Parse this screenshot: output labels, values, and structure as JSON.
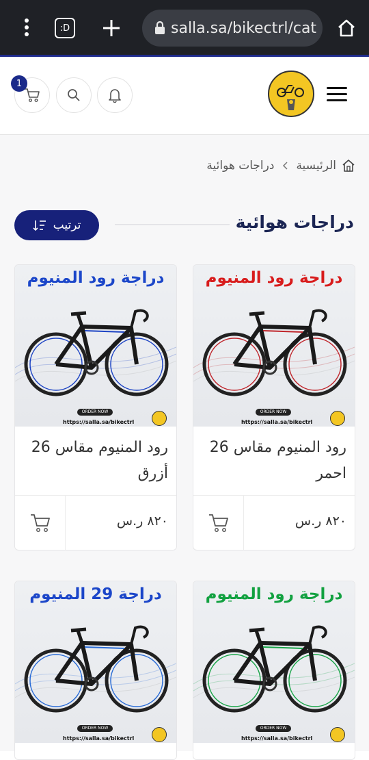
{
  "browser": {
    "url": "salla.sa/bikectrl/cat",
    "tab_label": ":D"
  },
  "header": {
    "cart_count": "1"
  },
  "breadcrumb": {
    "home": "الرئيسية",
    "current": "دراجات هوائية"
  },
  "page": {
    "title": "دراجات هوائية",
    "sort_label": "ترتيب"
  },
  "colors": {
    "primary": "#17217a",
    "badge": "#1b2a8a",
    "title": "#1b2553",
    "logo_yellow": "#f3c623"
  },
  "products": [
    {
      "image_title": "دراجة رود المنيوم",
      "image_title_color": "#d81c1c",
      "bike_accent": "#c0262c",
      "name": "رود المنيوم مقاس 26 احمر",
      "price": "٨٢٠ ر.س",
      "order_label": "ORDER NOW",
      "site": "https://salla.sa/bikectrl"
    },
    {
      "image_title": "دراجة رود المنيوم",
      "image_title_color": "#1b46c9",
      "bike_accent": "#1d44c4",
      "name": "رود المنيوم مقاس 26 أزرق",
      "price": "٨٢٠ ر.س",
      "order_label": "ORDER NOW",
      "site": "https://salla.sa/bikectrl"
    },
    {
      "image_title": "دراجة رود المنيوم",
      "image_title_color": "#12a140",
      "bike_accent": "#19a548",
      "name": "",
      "price": "",
      "order_label": "ORDER NOW",
      "site": "https://salla.sa/bikectrl"
    },
    {
      "image_title": "دراجة 29 المنيوم",
      "image_title_color": "#1b46c9",
      "bike_accent": "#2a6cd6",
      "name": "",
      "price": "",
      "order_label": "ORDER NOW",
      "site": "https://salla.sa/bikectrl"
    }
  ]
}
